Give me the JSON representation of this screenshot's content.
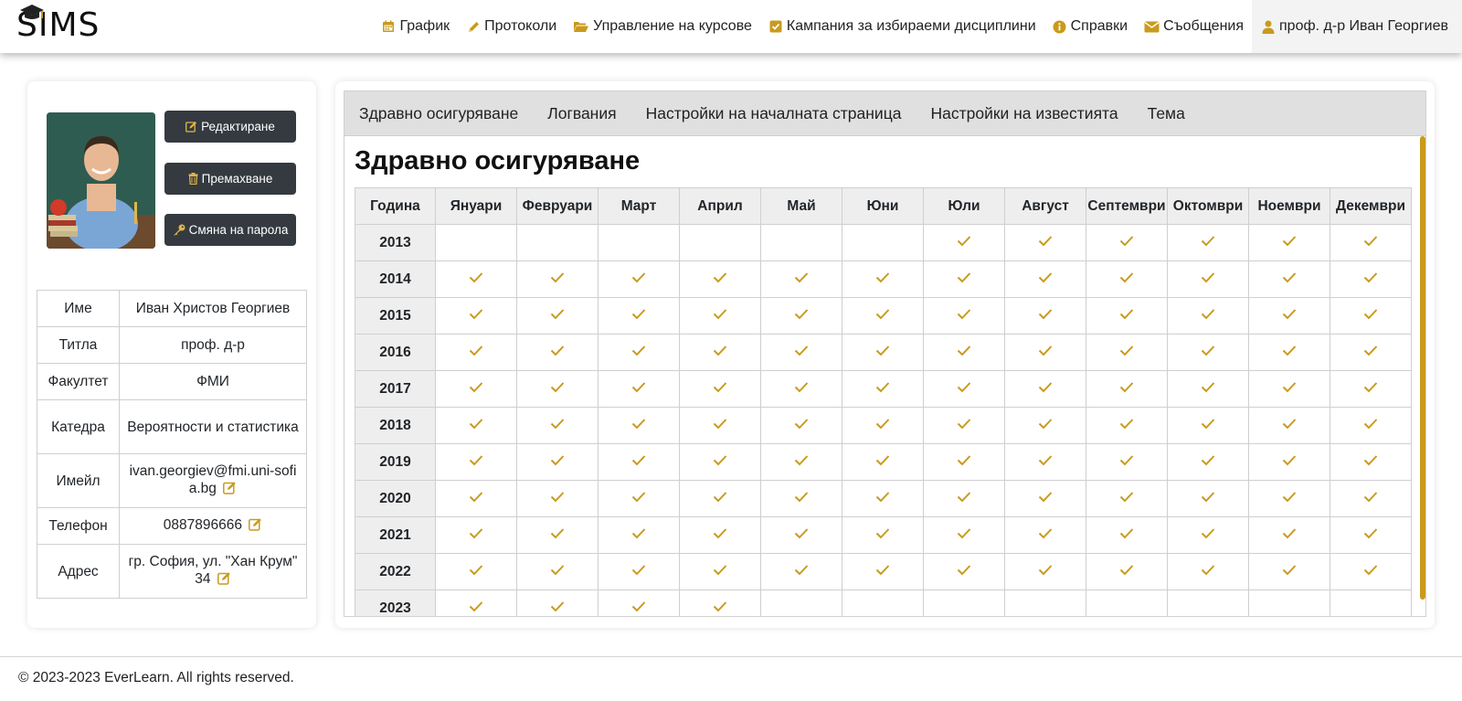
{
  "logo": {
    "text": "SIMS"
  },
  "nav": {
    "items": [
      {
        "label": "График",
        "icon": "calendar-icon"
      },
      {
        "label": "Протоколи",
        "icon": "pencil-icon"
      },
      {
        "label": "Управление на курсове",
        "icon": "folder-open-icon"
      },
      {
        "label": "Кампания за избираеми дисциплини",
        "icon": "check-square-icon"
      },
      {
        "label": "Справки",
        "icon": "info-circle-icon"
      },
      {
        "label": "Съобщения",
        "icon": "envelope-icon"
      }
    ],
    "user": {
      "label": "проф. д-р Иван Георгиев",
      "icon": "user-icon"
    }
  },
  "profile": {
    "buttons": {
      "edit": "Редактиране",
      "remove": "Премахване",
      "change_password": "Смяна на парола"
    },
    "fields": [
      {
        "key": "Име",
        "value": "Иван Христов Георгиев",
        "editable": false
      },
      {
        "key": "Титла",
        "value": "проф. д-р",
        "editable": false
      },
      {
        "key": "Факултет",
        "value": "ФМИ",
        "editable": false
      },
      {
        "key": "Катедра",
        "value": "Вероятности и статистика",
        "editable": false
      },
      {
        "key": "Имейл",
        "value": "ivan.georgiev@fmi.uni-sofia.bg",
        "editable": true
      },
      {
        "key": "Телефон",
        "value": "0887896666",
        "editable": true
      },
      {
        "key": "Адрес",
        "value": "гр. София, ул. \"Хан Крум\" 34",
        "editable": true
      }
    ]
  },
  "tabs": [
    "Здравно осигуряване",
    "Логвания",
    "Настройки на началната страница",
    "Настройки на известията",
    "Тема"
  ],
  "insurance": {
    "title": "Здравно осигуряване",
    "year_header": "Година",
    "months": [
      "Януари",
      "Февруари",
      "Март",
      "Април",
      "Май",
      "Юни",
      "Юли",
      "Август",
      "Септември",
      "Октомври",
      "Ноември",
      "Декември"
    ],
    "rows": [
      {
        "year": "2013",
        "paid": [
          false,
          false,
          false,
          false,
          false,
          false,
          true,
          true,
          true,
          true,
          true,
          true
        ]
      },
      {
        "year": "2014",
        "paid": [
          true,
          true,
          true,
          true,
          true,
          true,
          true,
          true,
          true,
          true,
          true,
          true
        ]
      },
      {
        "year": "2015",
        "paid": [
          true,
          true,
          true,
          true,
          true,
          true,
          true,
          true,
          true,
          true,
          true,
          true
        ]
      },
      {
        "year": "2016",
        "paid": [
          true,
          true,
          true,
          true,
          true,
          true,
          true,
          true,
          true,
          true,
          true,
          true
        ]
      },
      {
        "year": "2017",
        "paid": [
          true,
          true,
          true,
          true,
          true,
          true,
          true,
          true,
          true,
          true,
          true,
          true
        ]
      },
      {
        "year": "2018",
        "paid": [
          true,
          true,
          true,
          true,
          true,
          true,
          true,
          true,
          true,
          true,
          true,
          true
        ]
      },
      {
        "year": "2019",
        "paid": [
          true,
          true,
          true,
          true,
          true,
          true,
          true,
          true,
          true,
          true,
          true,
          true
        ]
      },
      {
        "year": "2020",
        "paid": [
          true,
          true,
          true,
          true,
          true,
          true,
          true,
          true,
          true,
          true,
          true,
          true
        ]
      },
      {
        "year": "2021",
        "paid": [
          true,
          true,
          true,
          true,
          true,
          true,
          true,
          true,
          true,
          true,
          true,
          true
        ]
      },
      {
        "year": "2022",
        "paid": [
          true,
          true,
          true,
          true,
          true,
          true,
          true,
          true,
          true,
          true,
          true,
          true
        ]
      },
      {
        "year": "2023",
        "paid": [
          true,
          true,
          true,
          true,
          false,
          false,
          false,
          false,
          false,
          false,
          false,
          false
        ]
      }
    ]
  },
  "footer": {
    "text": "© 2023-2023 EverLearn. All rights reserved."
  },
  "colors": {
    "accent": "#c99a1c",
    "button_dark": "#343a40",
    "header_cell": "#eeeeee",
    "tabs_bg": "#e0e0e0"
  }
}
